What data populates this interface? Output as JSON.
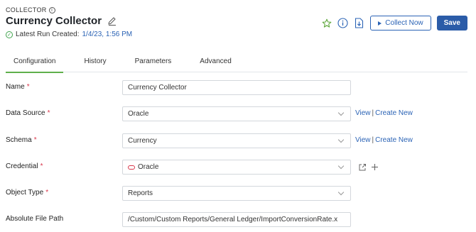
{
  "header": {
    "eyebrow": "COLLECTOR",
    "title": "Currency Collector",
    "run_label": "Latest Run Created:",
    "run_date": "1/4/23, 1:56 PM"
  },
  "toolbar": {
    "collect_label": "Collect Now",
    "save_label": "Save"
  },
  "tabs": [
    {
      "label": "Configuration",
      "active": true
    },
    {
      "label": "History"
    },
    {
      "label": "Parameters"
    },
    {
      "label": "Advanced"
    }
  ],
  "form": {
    "name": {
      "label": "Name",
      "value": "Currency Collector"
    },
    "data_source": {
      "label": "Data Source",
      "value": "Oracle",
      "view": "View",
      "create": "Create New"
    },
    "schema": {
      "label": "Schema",
      "value": "Currency",
      "view": "View",
      "create": "Create New"
    },
    "credential": {
      "label": "Credential",
      "value": "Oracle"
    },
    "object_type": {
      "label": "Object Type",
      "value": "Reports"
    },
    "file_path": {
      "label": "Absolute File Path",
      "value": "/Custom/Custom Reports/General Ledger/ImportConversionRate.x"
    },
    "required_mark": "*"
  },
  "icons": {
    "star": "star-icon",
    "info": "info-icon",
    "download": "file-download-icon",
    "edit": "pencil-icon",
    "external": "external-link-icon",
    "add": "plus-icon"
  },
  "colors": {
    "accent": "#2b63b5",
    "save_bg": "#2b5ca8",
    "tab_underline": "#5fb04b",
    "required": "#d9364a",
    "success": "#3fa34d"
  }
}
